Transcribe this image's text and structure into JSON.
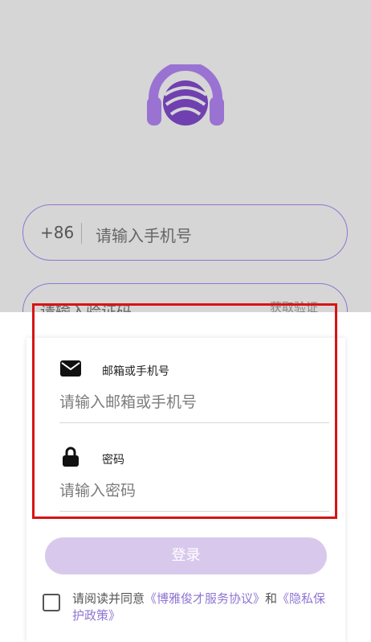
{
  "top": {
    "country_code": "+86",
    "phone_placeholder": "请输入手机号",
    "code_placeholder": "请输入验证码",
    "get_code_label": "获取验证"
  },
  "form": {
    "email_label": "邮箱或手机号",
    "email_placeholder": "请输入邮箱或手机号",
    "password_label": "密码",
    "password_placeholder": "请输入密码",
    "login_label": "登录"
  },
  "agreement": {
    "prefix": "请阅读并同意",
    "service_link": "《博雅俊才服务协议》",
    "and": "和",
    "privacy_link": "《隐私保护政策》"
  },
  "colors": {
    "accent": "#8f75d2",
    "button_disabled": "#d8c9ec",
    "highlight": "#d81414"
  },
  "icons": [
    "headphones-logo-icon",
    "mail-icon",
    "lock-icon"
  ]
}
